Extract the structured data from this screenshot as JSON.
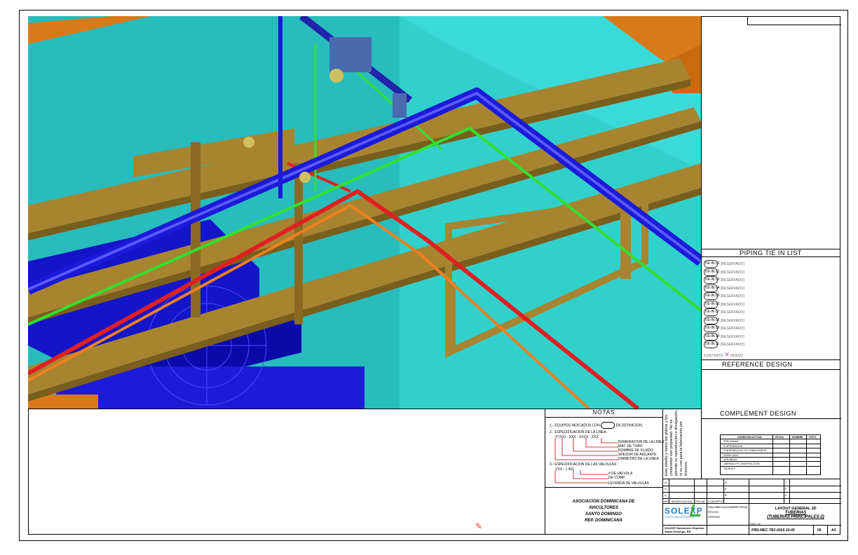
{
  "panel": {
    "piping_tie_title": "PIPING TIE IN LIST",
    "tie_ins": [
      {
        "tag": "TIE-IN 01",
        "status": "[RESERVADO]"
      },
      {
        "tag": "TIE-IN 02",
        "status": "[RESERVADO]"
      },
      {
        "tag": "TIE-IN 03",
        "status": "[RESERVADO]"
      },
      {
        "tag": "TIE-IN 04",
        "status": "[RESERVADO]"
      },
      {
        "tag": "TIE-IN 05",
        "status": "[RESERVADO]"
      },
      {
        "tag": "TIE-IN 06",
        "status": "[RESERVADO]"
      },
      {
        "tag": "TIE-IN 07",
        "status": "[RESERVADO]"
      },
      {
        "tag": "TIE-IN 08",
        "status": "[RESERVADO]"
      },
      {
        "tag": "TIE-IN 09",
        "status": "[RESERVADO]"
      },
      {
        "tag": "TIE-IN 10",
        "status": "[RESERVADO]"
      },
      {
        "tag": "TIE-IN 11",
        "status": "[RESERVADO]"
      }
    ],
    "existing_label": "EXISTENTE",
    "new_label": "NUEVO",
    "reference_title": "REFERENCE DESIGN",
    "complement_title": "COMPLEMENT DESIGN"
  },
  "notes": {
    "title": "NOTAS",
    "n1": "1.- EQUIPOS INDICADOS CON",
    "n1b": "EN DEFINICION.",
    "n2": "2.- ESPECIFICACION DE LA LINEA",
    "n2code": "X\"(XX) - XXX - XXXX - XXX",
    "n2items": [
      "NUMERACION DE LA LINEA",
      "MAT. DE TUBO",
      "NOMBRE DE FLUIDO",
      "SPESOR DE AISLANTE",
      "DIAMETRO DE LA LINEA"
    ],
    "n3": "3.- ESPECIFICACION DE LAS VALVULAS :",
    "n3code": "VXX - 1 001",
    "n3items": [
      "# DE VALVULA",
      "DE COMP.",
      "LEYENDA DE VALVULAS"
    ]
  },
  "rotated_note": "Este diseño y todos los planos y los contenidos son propiedad. No se permite su reproducción o divulgación, ni su uso para la fabricación por terceros.",
  "status_table": {
    "headers": [
      "CONDICION ACTUAL",
      "FECHA",
      "NOMBRE",
      "VISTO"
    ],
    "rows": [
      "PRELIMINAR",
      "P/ APROBACION",
      "P/ APROBACION Y/O COMENTARIOS",
      "VERIFICADO",
      "APROBADO",
      "LIBERADO P/ CONSTRUCCION",
      "\"AS BUILT\""
    ]
  },
  "revisions": {
    "cols": [
      "REV",
      "MODIFICACION",
      "FECHA",
      "CONCEPTO"
    ],
    "letters_a": [
      "H",
      "G",
      "A"
    ],
    "letters_b": [
      "H",
      "E",
      "B"
    ],
    "letters_c": [
      "J",
      "F",
      "C"
    ],
    "approval": [
      "DIBUJO",
      "REVISO",
      "APROBO",
      "FECHA",
      "NOMBRE",
      "FIRMA"
    ]
  },
  "title_block": {
    "title1": "LAYOUT GENERAL 3D",
    "title2": "TUBERIAS",
    "title3": "(TUBERIAS PRINCIPALES-2)",
    "doc_label": "DOC. N°",
    "doc_no": "PRD-MEC-TB1-0016-10-00",
    "rev": "00",
    "size": "A3"
  },
  "owner": {
    "line1": "ASOCIACION DOMINICANA DE",
    "line2": "AVICULTORES",
    "line3": "SANTO DOMINGO",
    "line4": "REP. DOMINICANA"
  },
  "company": {
    "name": "SOLEXP",
    "tagline": "SOLUCIONES EXPERTAS",
    "address1": "SOLEXP Soluciones Expertas",
    "address2": "Santo Domingo, RD"
  }
}
